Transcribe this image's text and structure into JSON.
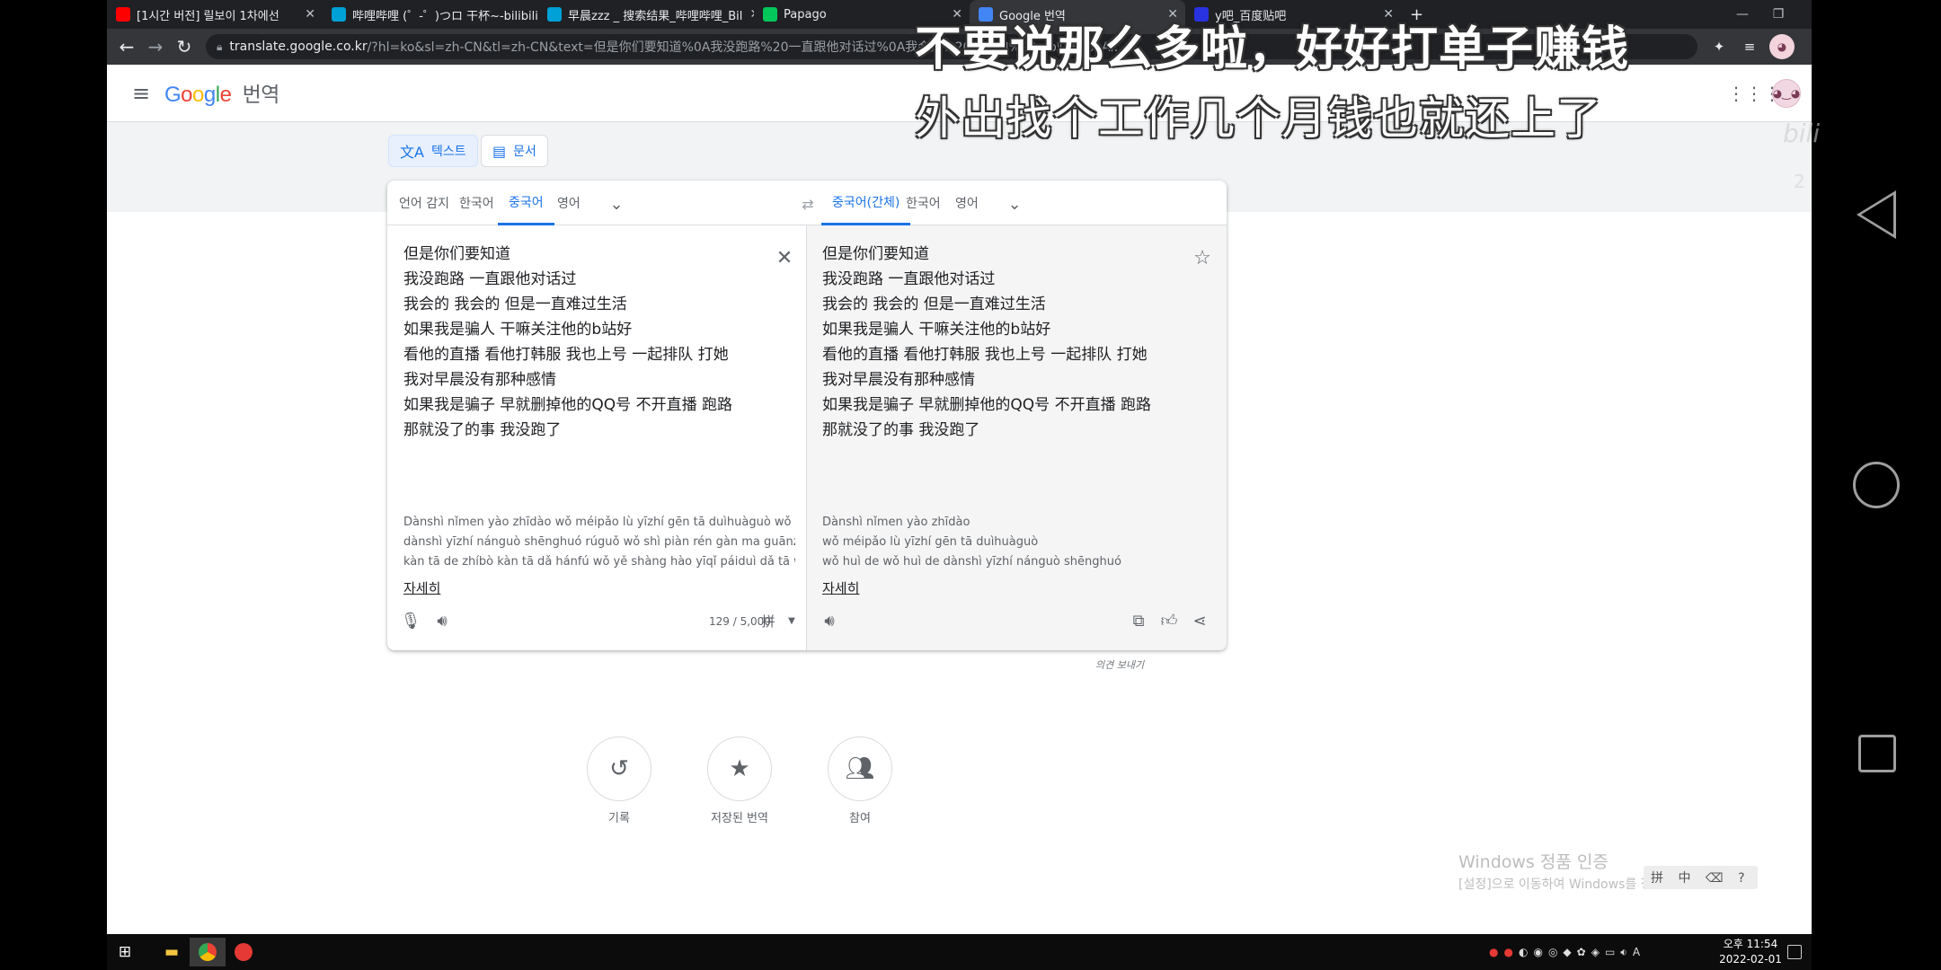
{
  "browser": {
    "tabs": [
      {
        "title": "[1시간 버전] 릴보이 1차에선",
        "favicon_color": "#ff0000"
      },
      {
        "title": "哔哩哔哩 (゜-゜)つロ 干杯~-bilibili",
        "favicon_color": "#00a1d6"
      },
      {
        "title": "早晨zzz _ 搜索结果_哔哩哔哩_Bil",
        "favicon_color": "#00a1d6"
      },
      {
        "title": "Papago",
        "favicon_color": "#03c75a"
      },
      {
        "title": "Google 번역",
        "favicon_color": "#4285f4"
      },
      {
        "title": "y吧_百度贴吧",
        "favicon_color": "#2932e1"
      }
    ],
    "new_tab": "+",
    "url_host": "translate.google.co.kr",
    "url_rest": "/?hl=ko&sl=zh-CN&tl=zh-CN&text=但是你们要知道%0A我没跑路%20一直跟他对话过%0A我会的%20我会的%20...b站好%0A...",
    "back": "←",
    "forward": "→",
    "reload": "↻"
  },
  "header": {
    "logo": [
      "G",
      "o",
      "o",
      "g",
      "l",
      "e"
    ],
    "product": "번역",
    "menu_icon": "hamburger-icon",
    "apps_icon": "apps-grid-icon"
  },
  "modes": {
    "text": "텍스트",
    "document": "문서"
  },
  "source": {
    "langs": [
      "언어 감지",
      "한국어",
      "중국어",
      "영어"
    ],
    "selected": "중국어",
    "text": "但是你们要知道\n我没跑路 一直跟他对话过\n我会的 我会的 但是一直难过生活\n如果我是骗人 干嘛关注他的b站好\n看他的直播 看他打韩服 我也上号 一起排队 打她\n我对早晨没有那种感情\n如果我是骗子 早就删掉他的QQ号 不开直播 跑路\n那就没了的事 我没跑了",
    "translit": [
      "Dànshì nǐmen yào zhīdào wǒ méipǎo lù yīzhí gēn tā duìhuàguò wǒ huì de wǒ huì de",
      "dànshì yīzhí nánguò shēnghuó rúguǒ wǒ shì piàn rén gàn ma guānzhù tā de b zhàn hǎo",
      "kàn tā de zhíbò kàn tā dǎ hánfú wǒ yě shàng hào yīqǐ páiduì dǎ tā wǒ duì zǎochén méiyǒu"
    ],
    "more": "자세히",
    "char_count": "129 / 5,000",
    "ime_label": "拼"
  },
  "target": {
    "langs": [
      "중국어(간체)",
      "한국어",
      "영어"
    ],
    "selected": "중국어(간체)",
    "text": "但是你们要知道\n我没跑路 一直跟他对话过\n我会的 我会的 但是一直难过生活\n如果我是骗人 干嘛关注他的b站好\n看他的直播 看他打韩服 我也上号 一起排队 打她\n我对早晨没有那种感情\n如果我是骗子 早就删掉他的QQ号 不开直播 跑路\n那就没了的事 我没跑了",
    "translit": [
      "Dànshì nǐmen yào zhīdào",
      "wǒ méipǎo lù yīzhí gēn tā duìhuàguò",
      "wǒ huì de wǒ huì de dànshì yīzhí nánguò shēnghuó"
    ],
    "more": "자세히"
  },
  "feedback": "의견 보내기",
  "bottom_actions": [
    {
      "label": "기록",
      "icon": "history-icon"
    },
    {
      "label": "저장된 번역",
      "icon": "star-icon"
    },
    {
      "label": "참여",
      "icon": "community-icon"
    }
  ],
  "watermark": {
    "title": "Windows 정품 인증",
    "subtitle": "[설정]으로 이동하여 Windows를 정품 인증합니다."
  },
  "ime_bar": "拼 中 ⌫ ?",
  "taskbar": {
    "clock_time": "오후 11:54",
    "clock_date": "2022-02-01",
    "lang": "A"
  },
  "subtitles": {
    "line1": "不要说那么多啦，好好打单子赚钱",
    "line2": "外出找个工作几个月钱也就还上了"
  },
  "overlay": {
    "bili": "bili",
    "num": "2"
  }
}
